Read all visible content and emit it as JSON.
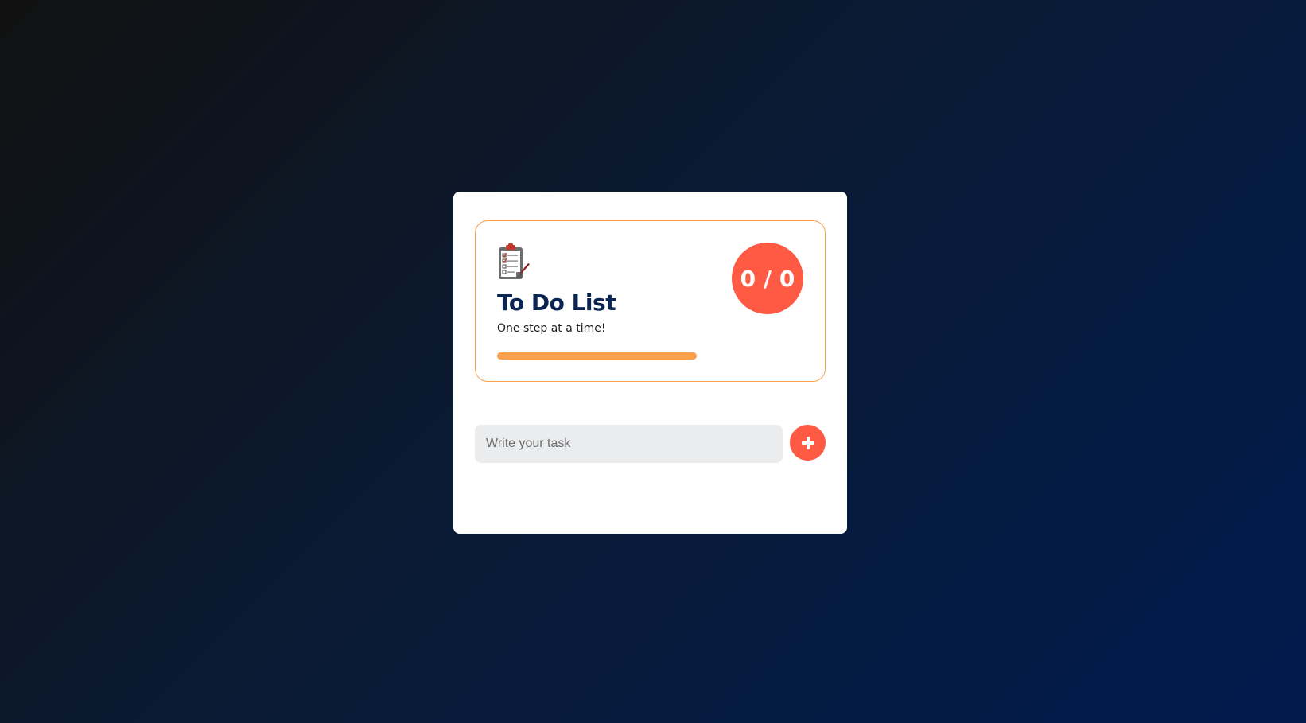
{
  "app": {
    "title": "To Do List",
    "subtitle": "One step at a time!"
  },
  "stats": {
    "completed": 0,
    "total": 0,
    "counter_text": "0 / 0"
  },
  "progress": {
    "fraction": 1.0
  },
  "task_form": {
    "placeholder": "Write your task",
    "value": ""
  },
  "tasks": [],
  "colors": {
    "accent": "#ff5a44",
    "progress": "#f9a14a",
    "title": "#0b2552",
    "input_bg": "#ebecee"
  },
  "icons": {
    "header": "clipboard-checklist-icon",
    "add": "plus-icon"
  }
}
